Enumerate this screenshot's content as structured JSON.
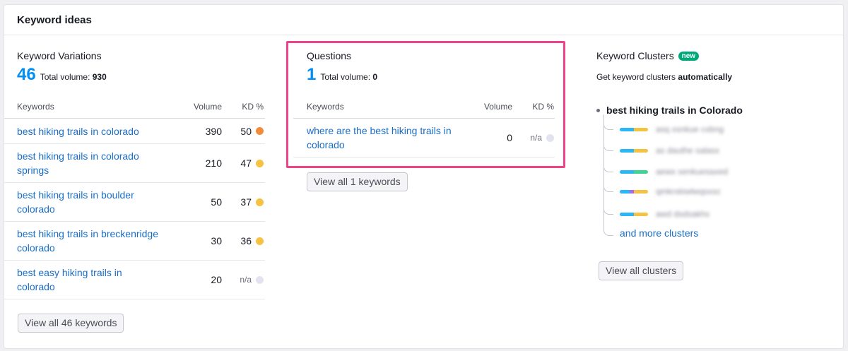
{
  "title": "Keyword ideas",
  "variations": {
    "heading": "Keyword Variations",
    "count": "46",
    "total_label": "Total volume:",
    "total_value": "930",
    "col_keywords": "Keywords",
    "col_volume": "Volume",
    "col_kd": "KD %",
    "rows": [
      {
        "keyword": "best hiking trails in colorado",
        "volume": "390",
        "kd": "50",
        "kd_color": "#f28c3a"
      },
      {
        "keyword": "best hiking trails in colorado springs",
        "volume": "210",
        "kd": "47",
        "kd_color": "#f5c242"
      },
      {
        "keyword": "best hiking trails in boulder colorado",
        "volume": "50",
        "kd": "37",
        "kd_color": "#f5c242"
      },
      {
        "keyword": "best hiking trails in breckenridge colorado",
        "volume": "30",
        "kd": "36",
        "kd_color": "#f5c242"
      },
      {
        "keyword": "best easy hiking trails in colorado",
        "volume": "20",
        "kd": "n/a",
        "kd_color": "#e2e3ee"
      }
    ],
    "button": "View all 46 keywords"
  },
  "questions": {
    "heading": "Questions",
    "count": "1",
    "total_label": "Total volume:",
    "total_value": "0",
    "col_keywords": "Keywords",
    "col_volume": "Volume",
    "col_kd": "KD %",
    "rows": [
      {
        "keyword": "where are the best hiking trails in colorado",
        "volume": "0",
        "kd": "n/a",
        "kd_color": "#e2e3ee"
      }
    ],
    "button": "View all 1 keywords"
  },
  "clusters": {
    "heading": "Keyword Clusters",
    "badge": "new",
    "subtitle_prefix": "Get keyword clusters",
    "subtitle_bold": "automatically",
    "root": "best hiking trails in Colorado",
    "items": [
      {
        "text": "asq xsnkue cxbng",
        "colors": [
          "#2bb6f5",
          "#2bb6f5",
          "#f5c242"
        ]
      },
      {
        "text": "as dauthe salasx",
        "colors": [
          "#2bb6f5",
          "#2bb6f5",
          "#f5c242"
        ]
      },
      {
        "text": "aewx senkuesaxed",
        "colors": [
          "#2bb6f5",
          "#2bb6f5",
          "#41d392"
        ]
      },
      {
        "text": "qmkrxkiwlwqsxsc",
        "colors": [
          "#2bb6f5",
          "#a66bf0",
          "#f5c242"
        ]
      },
      {
        "text": "awd dsdsakhs",
        "colors": [
          "#2bb6f5",
          "#2bb6f5",
          "#f5c242"
        ]
      }
    ],
    "more_link": "and more clusters",
    "button": "View all clusters"
  }
}
